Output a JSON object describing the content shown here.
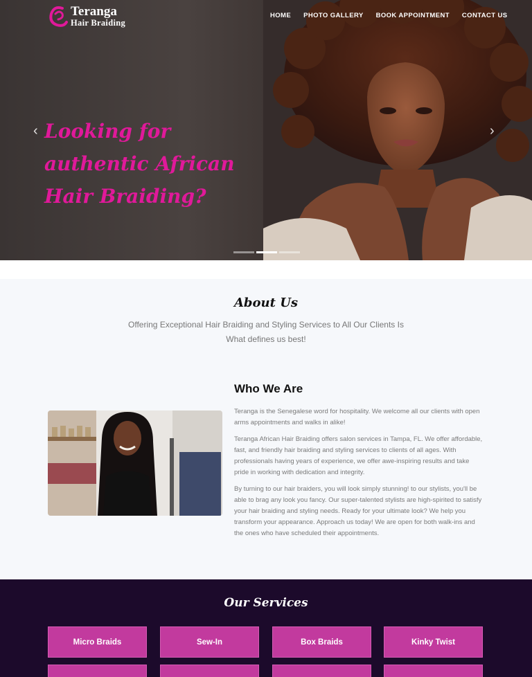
{
  "brand": {
    "line1": "Teranga",
    "line2": "Hair Braiding",
    "accent": "#e0199a"
  },
  "nav": [
    "HOME",
    "PHOTO GALLERY",
    "BOOK APPOINTMENT",
    "CONTACT US"
  ],
  "hero": {
    "headline": "Looking for authentic African Hair Braiding?",
    "prev_icon": "chevron-left-icon",
    "next_icon": "chevron-right-icon",
    "slides": 3,
    "active_slide": 2
  },
  "about": {
    "title": "About Us",
    "subtitle": "Offering Exceptional Hair Braiding and Styling Services to All Our Clients Is What defines us best!"
  },
  "who": {
    "title": "Who We Are",
    "paragraphs": [
      "Teranga is the Senegalese word for hospitality. We welcome all our clients with open arms appointments and walks in alike!",
      "Teranga African Hair Braiding offers salon services in Tampa, FL. We offer affordable, fast, and friendly hair braiding and styling services to clients of all ages. With professionals having years of experience, we offer awe-inspiring results and take pride in working with dedication and integrity.",
      "By turning to our hair braiders, you will look simply stunning! to our stylists, you'll be able to brag any look you fancy. Our super-talented stylists are high-spirited to satisfy your hair braiding and styling needs. Ready for your ultimate look? We help you transform your appearance. Approach us today! We are open for both walk-ins and the ones who have scheduled their appointments."
    ]
  },
  "services": {
    "title": "Our Services",
    "items": [
      "Micro Braids",
      "Sew-In",
      "Box Braids",
      "Kinky Twist"
    ],
    "bg": "#1c0a2b",
    "button_color": "#c23a9e"
  }
}
